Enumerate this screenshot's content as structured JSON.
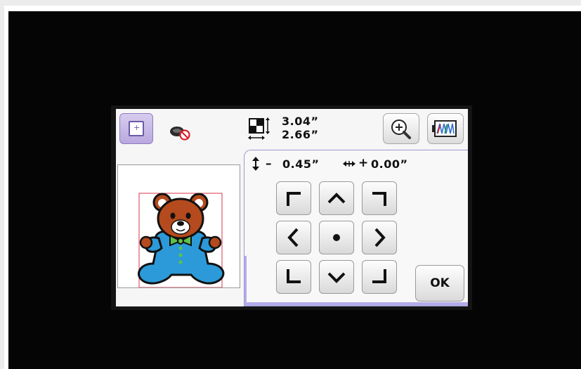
{
  "header": {
    "size_width": "3.04”",
    "size_height": "2.66”"
  },
  "offset": {
    "vertical_sign": "–",
    "vertical_value": "0.45”",
    "horizontal_sign": "+",
    "horizontal_value": "0.00”"
  },
  "buttons": {
    "ok_label": "OK"
  },
  "icons": {
    "frame": "embroidery-frame-icon",
    "thread": "no-thread-icon",
    "size": "design-size-icon",
    "zoom": "magnify-icon",
    "colors": "thread-colors-icon",
    "vertical": "vertical-arrows-icon",
    "horizontal": "horizontal-arrows-icon"
  },
  "colors": {
    "accent": "#b3acea",
    "selected": "#c9bce8",
    "no_symbol": "#d81f26"
  },
  "design": {
    "name": "teddy bear"
  }
}
